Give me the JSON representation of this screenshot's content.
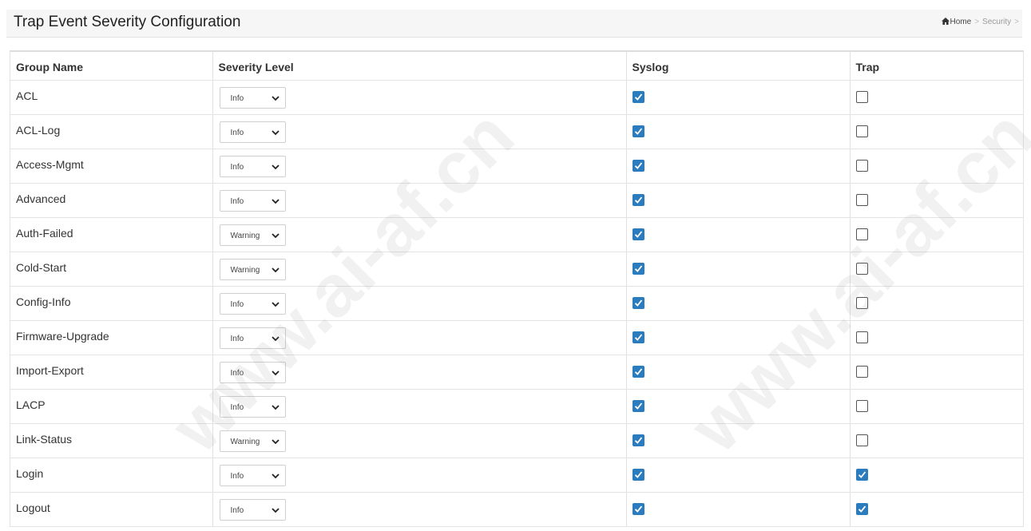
{
  "header": {
    "title": "Trap Event Severity Configuration",
    "breadcrumb": {
      "home": "Home",
      "current": "Security",
      "separator": ">"
    }
  },
  "table": {
    "columns": [
      "Group Name",
      "Severity Level",
      "Syslog",
      "Trap"
    ],
    "rows": [
      {
        "group": "ACL",
        "severity": "Info",
        "syslog": true,
        "trap": false
      },
      {
        "group": "ACL-Log",
        "severity": "Info",
        "syslog": true,
        "trap": false
      },
      {
        "group": "Access-Mgmt",
        "severity": "Info",
        "syslog": true,
        "trap": false
      },
      {
        "group": "Advanced",
        "severity": "Info",
        "syslog": true,
        "trap": false
      },
      {
        "group": "Auth-Failed",
        "severity": "Warning",
        "syslog": true,
        "trap": false
      },
      {
        "group": "Cold-Start",
        "severity": "Warning",
        "syslog": true,
        "trap": false
      },
      {
        "group": "Config-Info",
        "severity": "Info",
        "syslog": true,
        "trap": false
      },
      {
        "group": "Firmware-Upgrade",
        "severity": "Info",
        "syslog": true,
        "trap": false
      },
      {
        "group": "Import-Export",
        "severity": "Info",
        "syslog": true,
        "trap": false
      },
      {
        "group": "LACP",
        "severity": "Info",
        "syslog": true,
        "trap": false
      },
      {
        "group": "Link-Status",
        "severity": "Warning",
        "syslog": true,
        "trap": false
      },
      {
        "group": "Login",
        "severity": "Info",
        "syslog": true,
        "trap": true
      },
      {
        "group": "Logout",
        "severity": "Info",
        "syslog": true,
        "trap": true
      }
    ]
  },
  "watermark": {
    "text": "www.ai-af.cn",
    "badge": "ai-af"
  },
  "colors": {
    "checkbox_checked": "#2b7bbf",
    "header_bg": "#f6f6f6",
    "border": "#e3e3e3"
  }
}
